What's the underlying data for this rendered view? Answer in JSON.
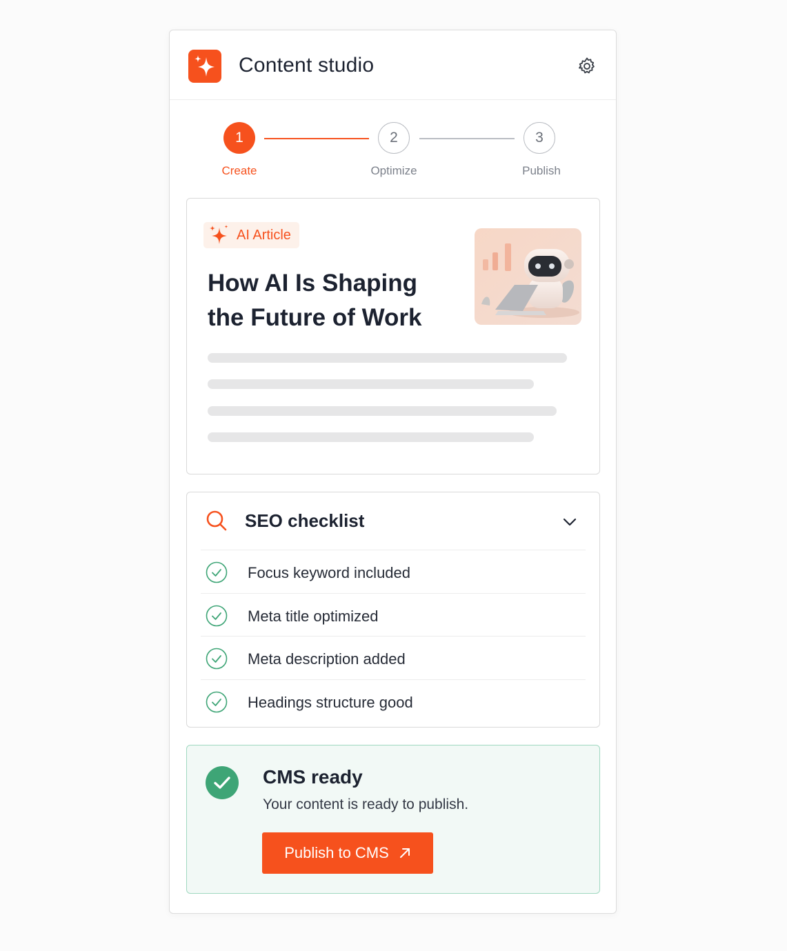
{
  "header": {
    "title": "Content studio",
    "logo_icon": "sparkle-icon",
    "settings_icon": "gear-icon"
  },
  "stepper": {
    "steps": [
      {
        "number": "1",
        "label": "Create",
        "state": "active"
      },
      {
        "number": "2",
        "label": "Optimize",
        "state": "upcoming"
      },
      {
        "number": "3",
        "label": "Publish",
        "state": "upcoming"
      }
    ]
  },
  "article": {
    "badge": "AI Article",
    "badge_icon": "sparkle-icon",
    "title": "How AI Is Shaping the Future of Work",
    "thumbnail": "robot-with-laptop-illustration"
  },
  "seo": {
    "title": "SEO checklist",
    "icon": "search-icon",
    "expand_icon": "chevron-down-icon",
    "items": [
      {
        "label": "Focus keyword included",
        "status": "done"
      },
      {
        "label": "Meta title optimized",
        "status": "done"
      },
      {
        "label": "Meta description added",
        "status": "done"
      },
      {
        "label": "Headings structure good",
        "status": "done"
      }
    ]
  },
  "cms": {
    "title": "CMS ready",
    "subtitle": "Your content is ready to publish.",
    "button_label": "Publish to CMS",
    "button_icon": "arrow-up-right-icon"
  },
  "colors": {
    "accent": "#f6511d",
    "success": "#3ea576",
    "success_bg": "#f2f9f6"
  }
}
